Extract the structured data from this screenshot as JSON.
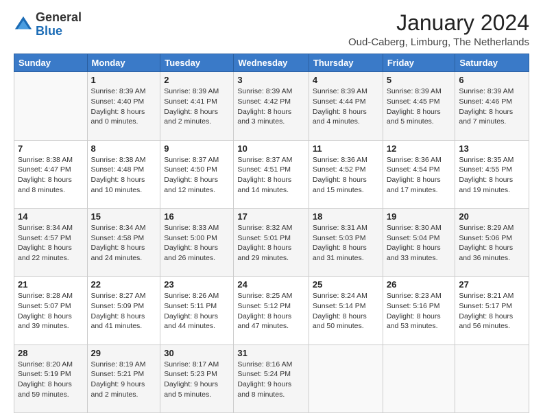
{
  "header": {
    "logo_general": "General",
    "logo_blue": "Blue",
    "month_title": "January 2024",
    "subtitle": "Oud-Caberg, Limburg, The Netherlands"
  },
  "columns": [
    "Sunday",
    "Monday",
    "Tuesday",
    "Wednesday",
    "Thursday",
    "Friday",
    "Saturday"
  ],
  "weeks": [
    [
      {
        "day": "",
        "info": ""
      },
      {
        "day": "1",
        "info": "Sunrise: 8:39 AM\nSunset: 4:40 PM\nDaylight: 8 hours\nand 0 minutes."
      },
      {
        "day": "2",
        "info": "Sunrise: 8:39 AM\nSunset: 4:41 PM\nDaylight: 8 hours\nand 2 minutes."
      },
      {
        "day": "3",
        "info": "Sunrise: 8:39 AM\nSunset: 4:42 PM\nDaylight: 8 hours\nand 3 minutes."
      },
      {
        "day": "4",
        "info": "Sunrise: 8:39 AM\nSunset: 4:44 PM\nDaylight: 8 hours\nand 4 minutes."
      },
      {
        "day": "5",
        "info": "Sunrise: 8:39 AM\nSunset: 4:45 PM\nDaylight: 8 hours\nand 5 minutes."
      },
      {
        "day": "6",
        "info": "Sunrise: 8:39 AM\nSunset: 4:46 PM\nDaylight: 8 hours\nand 7 minutes."
      }
    ],
    [
      {
        "day": "7",
        "info": "Sunrise: 8:38 AM\nSunset: 4:47 PM\nDaylight: 8 hours\nand 8 minutes."
      },
      {
        "day": "8",
        "info": "Sunrise: 8:38 AM\nSunset: 4:48 PM\nDaylight: 8 hours\nand 10 minutes."
      },
      {
        "day": "9",
        "info": "Sunrise: 8:37 AM\nSunset: 4:50 PM\nDaylight: 8 hours\nand 12 minutes."
      },
      {
        "day": "10",
        "info": "Sunrise: 8:37 AM\nSunset: 4:51 PM\nDaylight: 8 hours\nand 14 minutes."
      },
      {
        "day": "11",
        "info": "Sunrise: 8:36 AM\nSunset: 4:52 PM\nDaylight: 8 hours\nand 15 minutes."
      },
      {
        "day": "12",
        "info": "Sunrise: 8:36 AM\nSunset: 4:54 PM\nDaylight: 8 hours\nand 17 minutes."
      },
      {
        "day": "13",
        "info": "Sunrise: 8:35 AM\nSunset: 4:55 PM\nDaylight: 8 hours\nand 19 minutes."
      }
    ],
    [
      {
        "day": "14",
        "info": "Sunrise: 8:34 AM\nSunset: 4:57 PM\nDaylight: 8 hours\nand 22 minutes."
      },
      {
        "day": "15",
        "info": "Sunrise: 8:34 AM\nSunset: 4:58 PM\nDaylight: 8 hours\nand 24 minutes."
      },
      {
        "day": "16",
        "info": "Sunrise: 8:33 AM\nSunset: 5:00 PM\nDaylight: 8 hours\nand 26 minutes."
      },
      {
        "day": "17",
        "info": "Sunrise: 8:32 AM\nSunset: 5:01 PM\nDaylight: 8 hours\nand 29 minutes."
      },
      {
        "day": "18",
        "info": "Sunrise: 8:31 AM\nSunset: 5:03 PM\nDaylight: 8 hours\nand 31 minutes."
      },
      {
        "day": "19",
        "info": "Sunrise: 8:30 AM\nSunset: 5:04 PM\nDaylight: 8 hours\nand 33 minutes."
      },
      {
        "day": "20",
        "info": "Sunrise: 8:29 AM\nSunset: 5:06 PM\nDaylight: 8 hours\nand 36 minutes."
      }
    ],
    [
      {
        "day": "21",
        "info": "Sunrise: 8:28 AM\nSunset: 5:07 PM\nDaylight: 8 hours\nand 39 minutes."
      },
      {
        "day": "22",
        "info": "Sunrise: 8:27 AM\nSunset: 5:09 PM\nDaylight: 8 hours\nand 41 minutes."
      },
      {
        "day": "23",
        "info": "Sunrise: 8:26 AM\nSunset: 5:11 PM\nDaylight: 8 hours\nand 44 minutes."
      },
      {
        "day": "24",
        "info": "Sunrise: 8:25 AM\nSunset: 5:12 PM\nDaylight: 8 hours\nand 47 minutes."
      },
      {
        "day": "25",
        "info": "Sunrise: 8:24 AM\nSunset: 5:14 PM\nDaylight: 8 hours\nand 50 minutes."
      },
      {
        "day": "26",
        "info": "Sunrise: 8:23 AM\nSunset: 5:16 PM\nDaylight: 8 hours\nand 53 minutes."
      },
      {
        "day": "27",
        "info": "Sunrise: 8:21 AM\nSunset: 5:17 PM\nDaylight: 8 hours\nand 56 minutes."
      }
    ],
    [
      {
        "day": "28",
        "info": "Sunrise: 8:20 AM\nSunset: 5:19 PM\nDaylight: 8 hours\nand 59 minutes."
      },
      {
        "day": "29",
        "info": "Sunrise: 8:19 AM\nSunset: 5:21 PM\nDaylight: 9 hours\nand 2 minutes."
      },
      {
        "day": "30",
        "info": "Sunrise: 8:17 AM\nSunset: 5:23 PM\nDaylight: 9 hours\nand 5 minutes."
      },
      {
        "day": "31",
        "info": "Sunrise: 8:16 AM\nSunset: 5:24 PM\nDaylight: 9 hours\nand 8 minutes."
      },
      {
        "day": "",
        "info": ""
      },
      {
        "day": "",
        "info": ""
      },
      {
        "day": "",
        "info": ""
      }
    ]
  ]
}
